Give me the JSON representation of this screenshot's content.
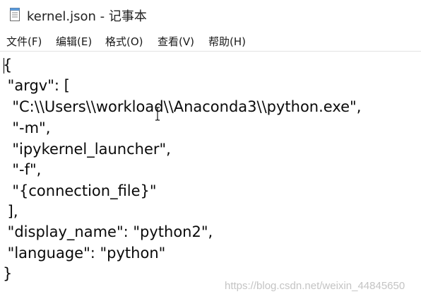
{
  "window": {
    "title": "kernel.json - 记事本",
    "icon": "notepad-icon"
  },
  "menu": {
    "items": [
      {
        "label": "文件(F)"
      },
      {
        "label": "编辑(E)"
      },
      {
        "label": "格式(O)"
      },
      {
        "label": "查看(V)"
      },
      {
        "label": "帮助(H)"
      }
    ]
  },
  "editor": {
    "lines": [
      "{",
      " \"argv\": [",
      "  \"C:\\\\Users\\\\workload\\\\Anaconda3\\\\python.exe\",",
      "  \"-m\",",
      "  \"ipykernel_launcher\",",
      "  \"-f\",",
      "  \"{connection_file}\"",
      " ],",
      " \"display_name\": \"python2\",",
      " \"language\": \"python\"",
      "}"
    ],
    "cursor_icon": "text-cursor-icon"
  },
  "watermark": "https://blog.csdn.net/weixin_44845650"
}
